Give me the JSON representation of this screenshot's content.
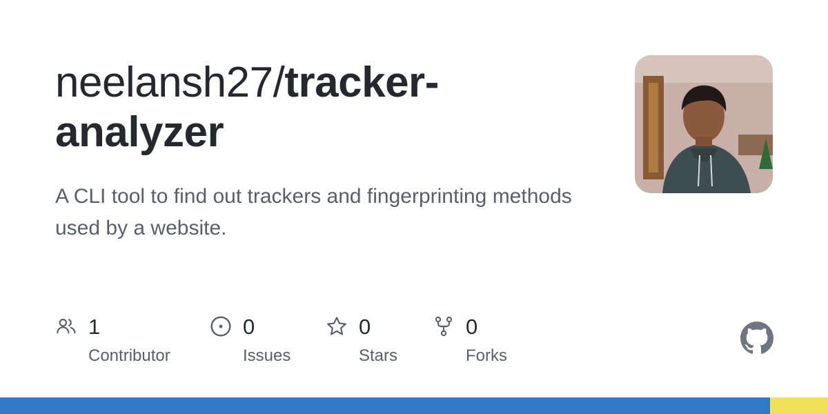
{
  "repo": {
    "owner_prefix": "neelansh27/",
    "name": "tracker-analyzer",
    "description": "A CLI tool to find out trackers and fingerprinting methods used by a website."
  },
  "avatar": {
    "icon": "user-avatar-photo"
  },
  "stats": [
    {
      "key": "contributors",
      "count": "1",
      "label": "Contributor",
      "icon": "people-icon"
    },
    {
      "key": "issues",
      "count": "0",
      "label": "Issues",
      "icon": "issue-opened-icon"
    },
    {
      "key": "stars",
      "count": "0",
      "label": "Stars",
      "icon": "star-icon"
    },
    {
      "key": "forks",
      "count": "0",
      "label": "Forks",
      "icon": "repo-forked-icon"
    }
  ],
  "brand": {
    "icon": "github-mark-icon",
    "color": "#6e7781"
  },
  "language_bar": [
    {
      "color": "#3178c6",
      "fraction": 0.93
    },
    {
      "color": "#f1e05a",
      "fraction": 0.07
    }
  ]
}
